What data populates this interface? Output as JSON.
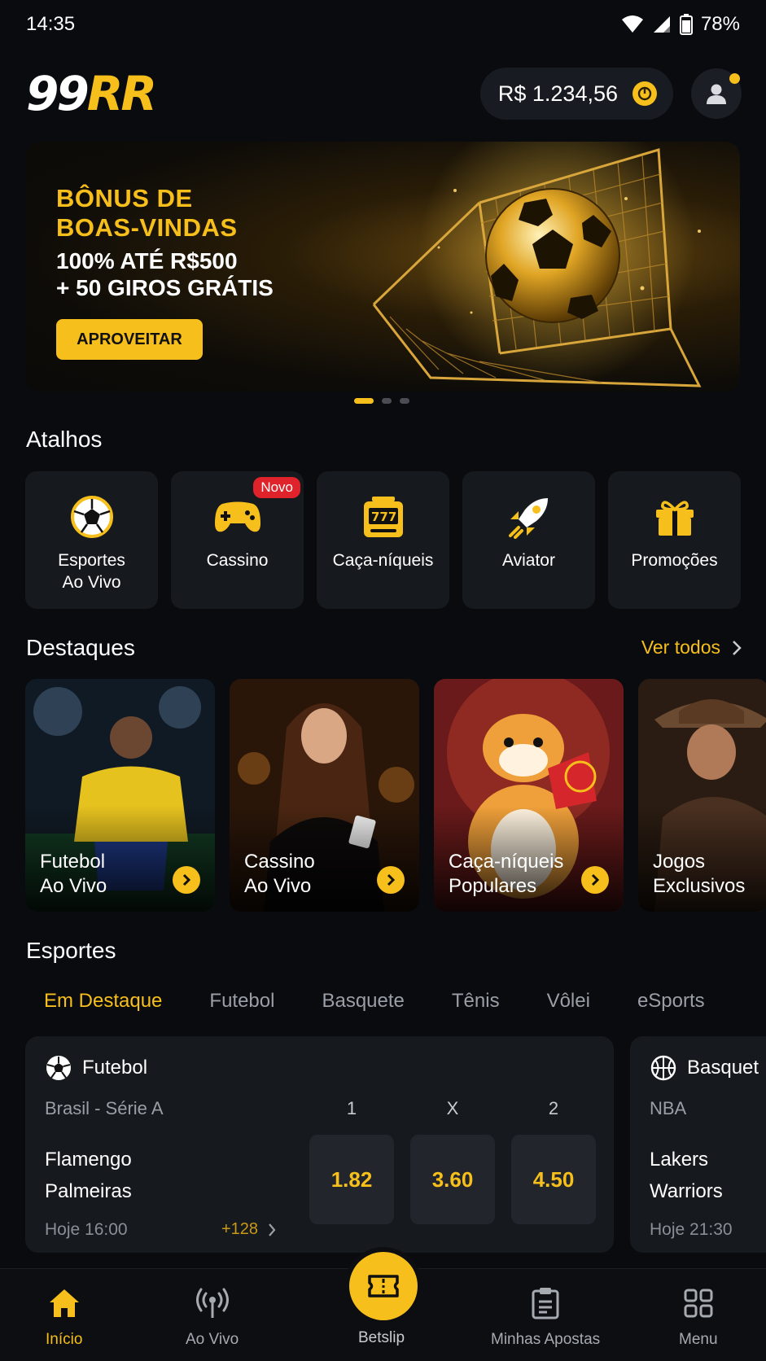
{
  "status_bar": {
    "time": "14:35",
    "battery": "78%"
  },
  "header": {
    "logo_part1": "99",
    "logo_part2": "RR",
    "balance": "R$ 1.234,56"
  },
  "banner": {
    "title_line1": "BÔNUS DE",
    "title_line2": "BOAS-VINDAS",
    "sub_line1": "100% ATÉ R$500",
    "sub_line2": "+ 50 GIROS GRÁTIS",
    "cta": "APROVEITAR",
    "pages": 3,
    "active_page": 1
  },
  "shortcuts": {
    "title": "Atalhos",
    "items": [
      {
        "label": "Esportes\nAo Vivo",
        "icon": "soccer-ball-icon"
      },
      {
        "label": "Cassino",
        "icon": "gamepad-icon",
        "badge": "Novo"
      },
      {
        "label": "Caça-níqueis",
        "icon": "slot-machine-icon"
      },
      {
        "label": "Aviator",
        "icon": "rocket-icon"
      },
      {
        "label": "Promoções",
        "icon": "gift-icon"
      }
    ]
  },
  "highlights": {
    "title": "Destaques",
    "see_all": "Ver todos",
    "items": [
      {
        "title": "Futebol\nAo Vivo"
      },
      {
        "title": "Cassino\nAo Vivo"
      },
      {
        "title": "Caça-níqueis\nPopulares"
      },
      {
        "title": "Jogos\nExclusivos"
      }
    ]
  },
  "sports": {
    "title": "Esportes",
    "tabs": [
      "Em Destaque",
      "Futebol",
      "Basquete",
      "Tênis",
      "Vôlei",
      "eSports"
    ],
    "active_tab": "Em Destaque",
    "matches": [
      {
        "sport": "Futebol",
        "league": "Brasil - Série A",
        "home": "Flamengo",
        "away": "Palmeiras",
        "time": "Hoje 16:00",
        "more_markets": "+128",
        "odds_headers": [
          "1",
          "X",
          "2"
        ],
        "odds": [
          "1.82",
          "3.60",
          "4.50"
        ]
      },
      {
        "sport": "Basquet",
        "league": "NBA",
        "home": "Lakers",
        "away": "Warriors",
        "time": "Hoje 21:30"
      }
    ]
  },
  "bottom_nav": {
    "items": [
      "Início",
      "Ao Vivo",
      "Betslip",
      "Minhas Apostas",
      "Menu"
    ],
    "active": "Início"
  },
  "colors": {
    "accent": "#f7bf1b",
    "background": "#090b0f",
    "card": "#16191e",
    "badge": "#e0222a"
  }
}
